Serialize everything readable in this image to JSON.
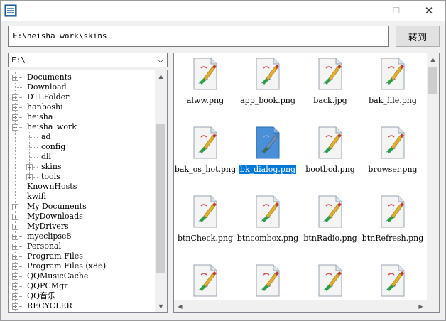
{
  "titlebar": {
    "minimize_glyph": "—",
    "maximize_glyph": "☐",
    "close_glyph": "✕"
  },
  "path_bar": {
    "value": "F:\\heisha_work\\skins",
    "go_label": "转到"
  },
  "drive_select": {
    "value": "F:\\",
    "arrow_glyph": "⌵"
  },
  "tree": {
    "items": [
      {
        "label": "Documents",
        "expandable": true,
        "level": 0
      },
      {
        "label": "Download",
        "expandable": false,
        "level": 0
      },
      {
        "label": "DTLFolder",
        "expandable": true,
        "level": 0
      },
      {
        "label": "hanboshi",
        "expandable": true,
        "level": 0
      },
      {
        "label": "heisha",
        "expandable": true,
        "level": 0
      },
      {
        "label": "heisha_work",
        "expandable": true,
        "expanded": true,
        "level": 0
      },
      {
        "label": "ad",
        "expandable": false,
        "level": 1
      },
      {
        "label": "config",
        "expandable": false,
        "level": 1
      },
      {
        "label": "dll",
        "expandable": false,
        "level": 1
      },
      {
        "label": "skins",
        "expandable": true,
        "level": 1
      },
      {
        "label": "tools",
        "expandable": true,
        "level": 1
      },
      {
        "label": "KnownHosts",
        "expandable": false,
        "level": 0
      },
      {
        "label": "kwifi",
        "expandable": false,
        "level": 0
      },
      {
        "label": "My Documents",
        "expandable": true,
        "level": 0
      },
      {
        "label": "MyDownloads",
        "expandable": true,
        "level": 0
      },
      {
        "label": "MyDrivers",
        "expandable": true,
        "level": 0
      },
      {
        "label": "myeclipse8",
        "expandable": true,
        "level": 0
      },
      {
        "label": "Personal",
        "expandable": true,
        "level": 0
      },
      {
        "label": "Program Files",
        "expandable": true,
        "level": 0
      },
      {
        "label": "Program Files (x86)",
        "expandable": true,
        "level": 0
      },
      {
        "label": "QQMusicCache",
        "expandable": true,
        "level": 0
      },
      {
        "label": "QQPCMgr",
        "expandable": true,
        "level": 0
      },
      {
        "label": "QQ音乐",
        "expandable": true,
        "level": 0
      },
      {
        "label": "RECYCLER",
        "expandable": true,
        "level": 0
      }
    ]
  },
  "files": [
    {
      "name": "alww.png",
      "selected": false
    },
    {
      "name": "app_book.png",
      "selected": false
    },
    {
      "name": "back.jpg",
      "selected": false
    },
    {
      "name": "bak_file.png",
      "selected": false
    },
    {
      "name": "bak_os_hot.png",
      "selected": false
    },
    {
      "name": "bk_dialog.png",
      "selected": true
    },
    {
      "name": "bootbcd.png",
      "selected": false
    },
    {
      "name": "browser.png",
      "selected": false
    },
    {
      "name": "btnCheck.png",
      "selected": false
    },
    {
      "name": "btncombox.png",
      "selected": false
    },
    {
      "name": "btnRadio.png",
      "selected": false
    },
    {
      "name": "btnRefresh.png",
      "selected": false
    },
    {
      "name": "",
      "selected": false
    },
    {
      "name": "",
      "selected": false
    },
    {
      "name": "",
      "selected": false
    },
    {
      "name": "",
      "selected": false
    }
  ],
  "colors": {
    "selection": "#0078d7",
    "window_bg": "#f0f0f0"
  }
}
